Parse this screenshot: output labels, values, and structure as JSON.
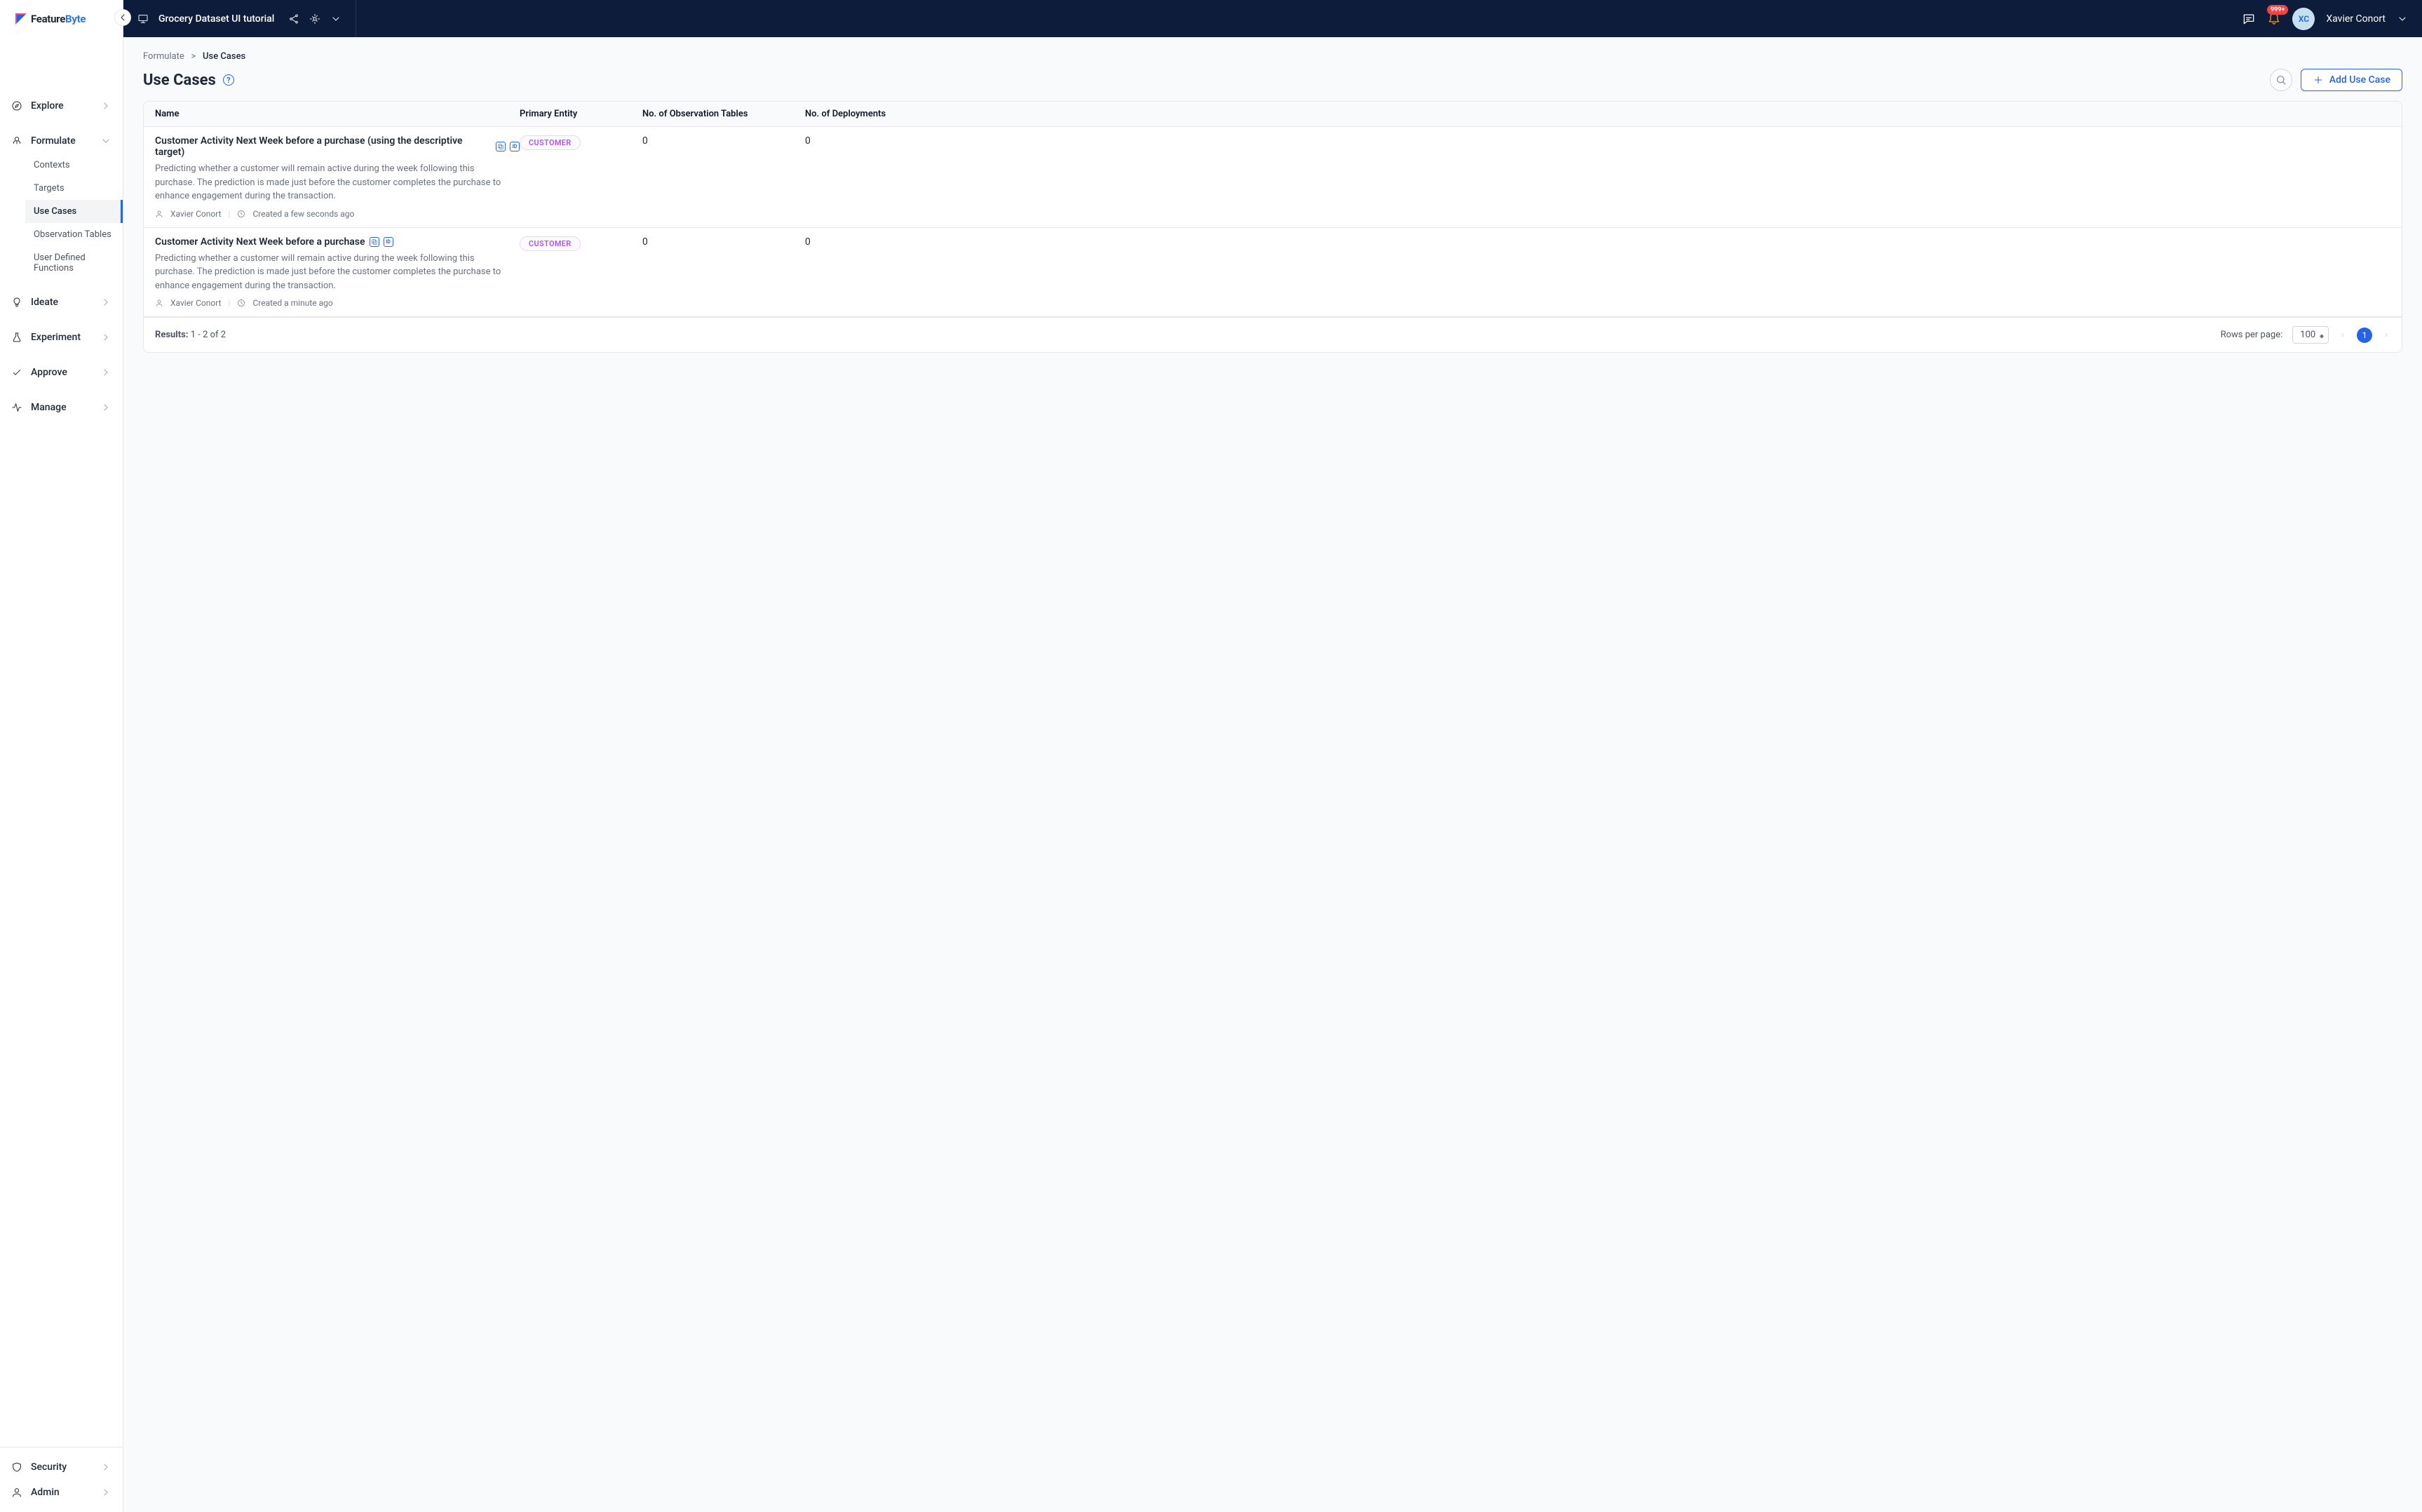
{
  "logo_text1": "Feature",
  "logo_text2": "Byte",
  "topbar": {
    "catalog_name": "Grocery Dataset UI tutorial",
    "notif_badge": "999+",
    "avatar_initials": "XC",
    "user_name": "Xavier Conort"
  },
  "sidebar": {
    "explore": "Explore",
    "formulate": "Formulate",
    "formulate_sub": {
      "contexts": "Contexts",
      "targets": "Targets",
      "use_cases": "Use Cases",
      "obs_tables": "Observation Tables",
      "udf": "User Defined Functions"
    },
    "ideate": "Ideate",
    "experiment": "Experiment",
    "approve": "Approve",
    "manage": "Manage",
    "security": "Security",
    "admin": "Admin"
  },
  "breadcrumb": {
    "root": "Formulate",
    "sep": ">",
    "current": "Use Cases"
  },
  "page": {
    "title": "Use Cases",
    "add_button": "Add Use Case"
  },
  "table": {
    "headers": {
      "name": "Name",
      "entity": "Primary Entity",
      "obs": "No. of Observation Tables",
      "dep": "No. of Deployments"
    },
    "rows": [
      {
        "title": "Customer Activity Next Week before a purchase (using the descriptive target)",
        "desc": "Predicting whether a customer will remain active during the week following this purchase. The prediction is made just before the customer completes the purchase to enhance engagement during the transaction.",
        "author": "Xavier Conort",
        "created": "Created a few seconds ago",
        "entity": "CUSTOMER",
        "obs": "0",
        "dep": "0"
      },
      {
        "title": "Customer Activity Next Week before a purchase",
        "desc": "Predicting whether a customer will remain active during the week following this purchase. The prediction is made just before the customer completes the purchase to enhance engagement during the transaction.",
        "author": "Xavier Conort",
        "created": "Created a minute ago",
        "entity": "CUSTOMER",
        "obs": "0",
        "dep": "0"
      }
    ],
    "results_label": "Results:",
    "results_value": "1 - 2 of 2",
    "rows_per_page_label": "Rows per page:",
    "rows_per_page_value": "100",
    "current_page": "1"
  }
}
